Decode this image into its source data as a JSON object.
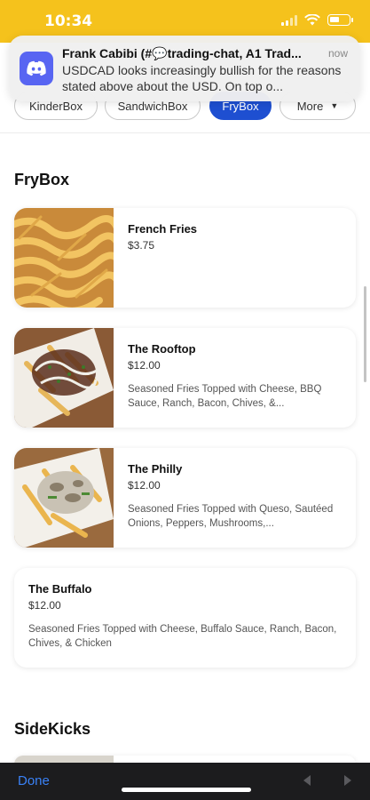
{
  "status": {
    "time": "10:34"
  },
  "categories": [
    {
      "label": "KinderBox"
    },
    {
      "label": "SandwichBox"
    },
    {
      "label": "FryBox"
    },
    {
      "label": "More"
    }
  ],
  "notification": {
    "app": "Discord",
    "title": "Frank Cabibi (#💬trading-chat, A1 Trad...",
    "time": "now",
    "body": "USDCAD looks increasingly bullish for the reasons stated above about the USD. On top o..."
  },
  "sections": [
    {
      "title": "FryBox",
      "items": [
        {
          "name": "French Fries",
          "price": "$3.75",
          "description": ""
        },
        {
          "name": "The Rooftop",
          "price": "$12.00",
          "description": "Seasoned Fries Topped with Cheese, BBQ Sauce, Ranch, Bacon, Chives, &..."
        },
        {
          "name": "The Philly",
          "price": "$12.00",
          "description": "Seasoned Fries Topped with Queso, Sautéed Onions, Peppers, Mushrooms,..."
        },
        {
          "name": "The Buffalo",
          "price": "$12.00",
          "description": "Seasoned Fries Topped with Cheese, Buffalo Sauce, Ranch, Bacon, Chives, & Chicken"
        }
      ]
    },
    {
      "title": "SideKicks"
    }
  ],
  "toolbar": {
    "done_label": "Done"
  },
  "colors": {
    "status_bar": "#f5c21c",
    "accent": "#1e4fd1",
    "discord": "#5865f2",
    "done": "#3a82f7"
  },
  "battery_level": 0.55
}
